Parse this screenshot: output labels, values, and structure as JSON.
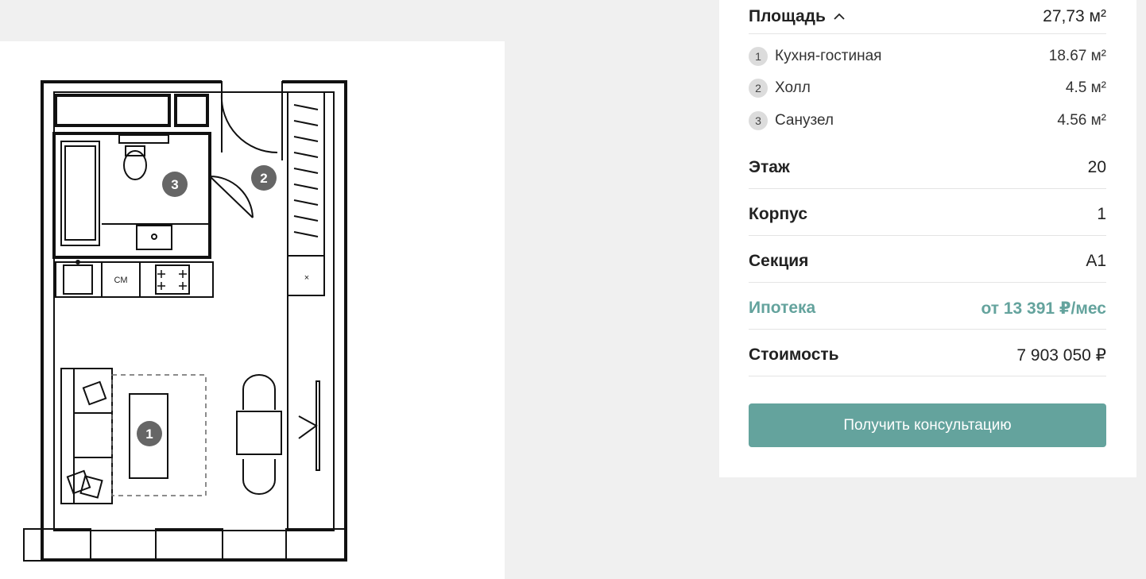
{
  "area": {
    "label": "Площадь",
    "value": "27,73 м²",
    "rooms": [
      {
        "num": "1",
        "name": "Кухня-гостиная",
        "area": "18.67 м²"
      },
      {
        "num": "2",
        "name": "Холл",
        "area": "4.5 м²"
      },
      {
        "num": "3",
        "name": "Санузел",
        "area": "4.56 м²"
      }
    ]
  },
  "floor": {
    "label": "Этаж",
    "value": "20"
  },
  "building": {
    "label": "Корпус",
    "value": "1"
  },
  "section": {
    "label": "Секция",
    "value": "А1"
  },
  "mortgage": {
    "label": "Ипотека",
    "value": "от 13 391 ₽/мес"
  },
  "price": {
    "label": "Стоимость",
    "value": "7 903 050 ₽"
  },
  "cta": {
    "label": "Получить консультацию"
  },
  "plan": {
    "markers": [
      "1",
      "2",
      "3"
    ],
    "washer_label": "СМ"
  },
  "colors": {
    "accent": "#64a39d",
    "background": "#f0f0f0",
    "card": "#ffffff",
    "badge": "#dcdcdc"
  }
}
